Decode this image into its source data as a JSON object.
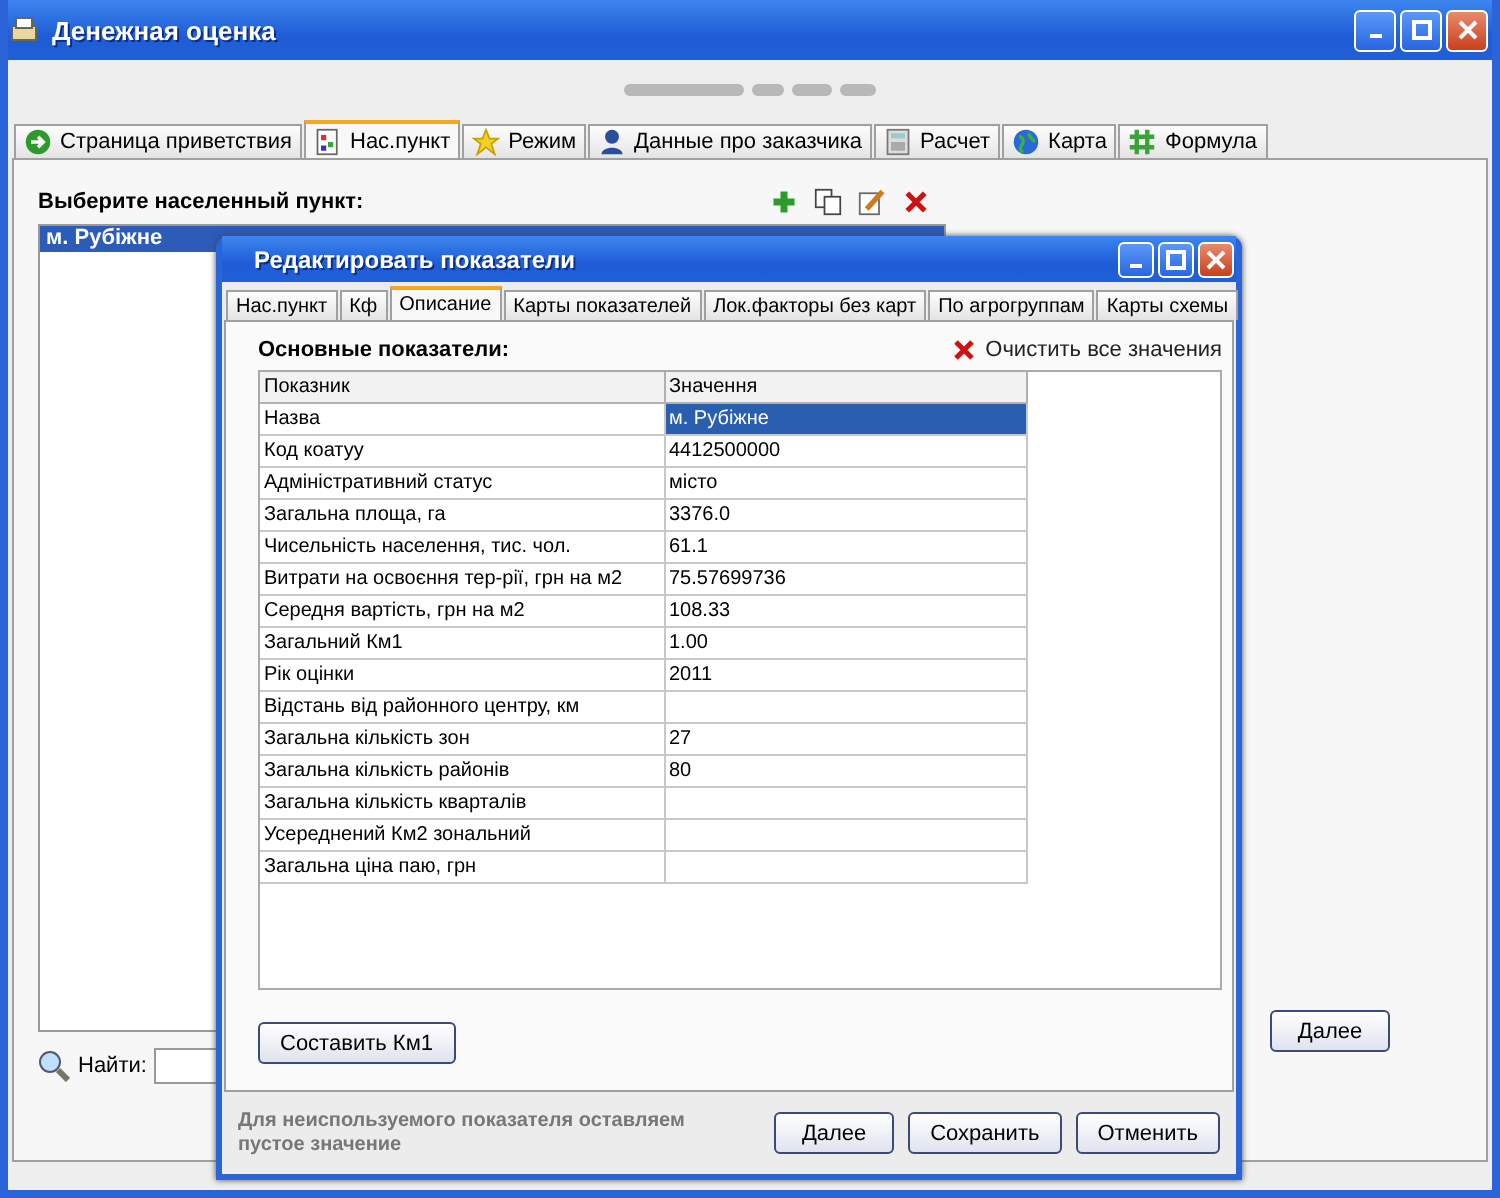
{
  "window": {
    "title": "Денежная оценка"
  },
  "tabs": [
    {
      "label": "Страница приветствия",
      "selected": false
    },
    {
      "label": "Нас.пункт",
      "selected": true
    },
    {
      "label": "Режим",
      "selected": false
    },
    {
      "label": "Данные про заказчика",
      "selected": false
    },
    {
      "label": "Расчет",
      "selected": false
    },
    {
      "label": "Карта",
      "selected": false
    },
    {
      "label": "Формула",
      "selected": false
    }
  ],
  "panel": {
    "prompt": "Выберите населенный пункт:",
    "list": [
      {
        "label": "м. Рубіжне",
        "selected": true
      }
    ],
    "search_label": "Найти:",
    "next_button": "Далее"
  },
  "dialog": {
    "title": "Редактировать показатели",
    "tabs": [
      {
        "label": "Нас.пункт",
        "selected": false
      },
      {
        "label": "Кф",
        "selected": false
      },
      {
        "label": "Описание",
        "selected": true
      },
      {
        "label": "Карты показателей",
        "selected": false
      },
      {
        "label": "Лок.факторы без карт",
        "selected": false
      },
      {
        "label": "По агрогруппам",
        "selected": false
      },
      {
        "label": "Карты схемы",
        "selected": false
      }
    ],
    "section_title": "Основные показатели:",
    "clear_label": "Очистить все значения",
    "columns": [
      "Показник",
      "Значення"
    ],
    "rows": [
      {
        "name": "Назва",
        "value": "м. Рубіжне",
        "selected": true
      },
      {
        "name": "Код коатуу",
        "value": "4412500000",
        "selected": false
      },
      {
        "name": "Адміністративний статус",
        "value": "місто",
        "selected": false
      },
      {
        "name": "Загальна площа, га",
        "value": "3376.0",
        "selected": false
      },
      {
        "name": "Чисельність населення, тис. чол.",
        "value": "61.1",
        "selected": false
      },
      {
        "name": "Витрати на освоєння тер-рії, грн на м2",
        "value": "75.57699736",
        "selected": false
      },
      {
        "name": "Середня вартість, грн на м2",
        "value": "108.33",
        "selected": false
      },
      {
        "name": "Загальний Км1",
        "value": "1.00",
        "selected": false
      },
      {
        "name": "Рік оцінки",
        "value": "2011",
        "selected": false
      },
      {
        "name": "Відстань від районного центру, км",
        "selected": false
      },
      {
        "name": "Загальна кількість зон",
        "value": "27",
        "selected": false
      },
      {
        "name": "Загальна кількість районів",
        "value": "80",
        "selected": false
      },
      {
        "name": "Загальна кількість кварталів",
        "selected": false
      },
      {
        "name": "Усереднений Км2 зональний",
        "selected": false
      },
      {
        "name": "Загальна ціна паю, грн",
        "selected": false
      }
    ],
    "compose_button": "Составить Км1",
    "note": "Для неиспользуемого показателя оставляем пустое значение",
    "buttons": [
      "Далее",
      "Сохранить",
      "Отменить"
    ]
  }
}
